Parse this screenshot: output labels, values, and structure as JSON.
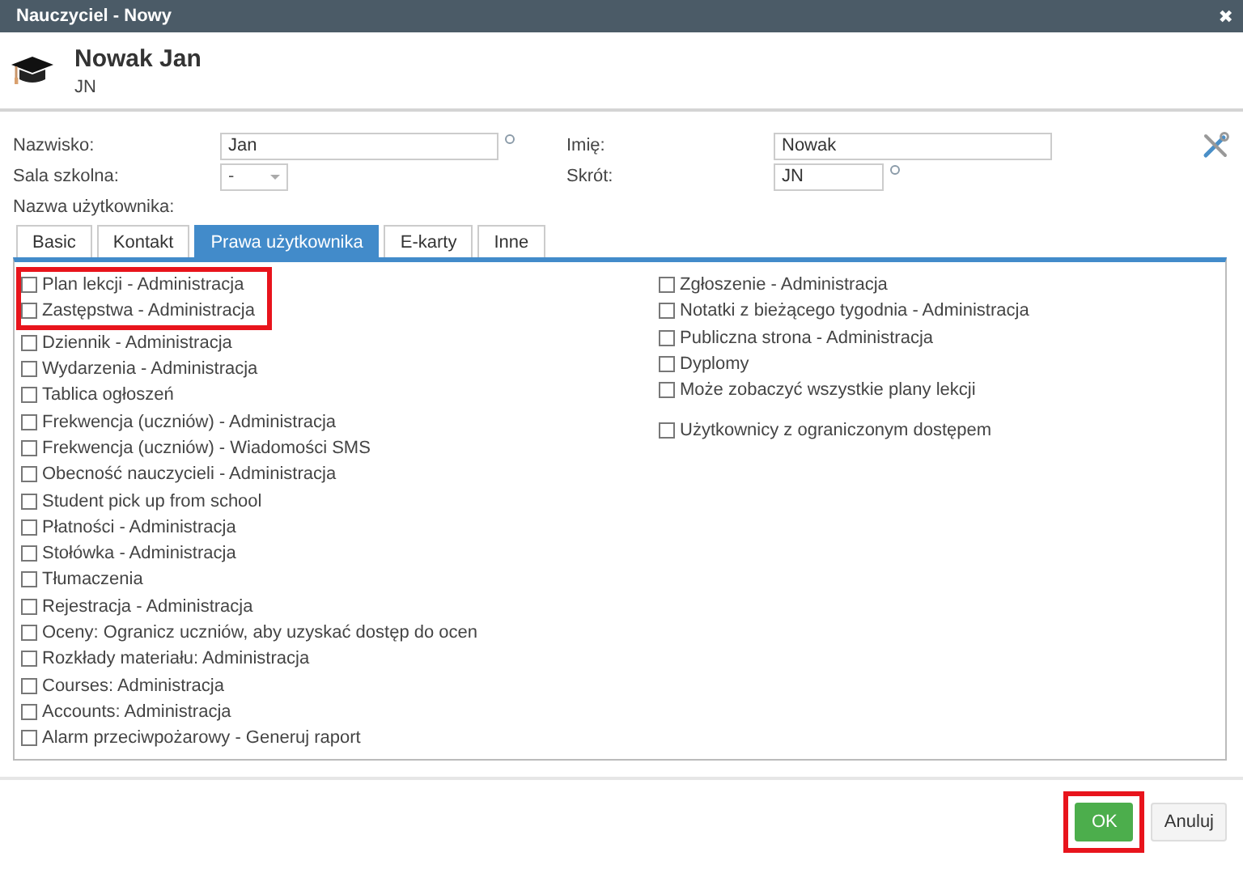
{
  "window": {
    "title": "Nauczyciel - Nowy",
    "close": "✖"
  },
  "header": {
    "name": "Nowak Jan",
    "initials": "JN"
  },
  "form": {
    "left": [
      {
        "kind": "input",
        "label": "Nazwisko:",
        "value": "Jan",
        "required": true
      },
      {
        "kind": "select",
        "label": "Sala szkolna:",
        "value": "-"
      },
      {
        "kind": "text",
        "label": "Nazwa użytkownika:"
      }
    ],
    "right": [
      {
        "kind": "input",
        "label": "Imię:",
        "value": "Nowak",
        "required": false
      },
      {
        "kind": "short",
        "label": "Skrót:",
        "value": "JN",
        "required": true
      }
    ]
  },
  "tabs": [
    {
      "label": "Basic",
      "selected": false
    },
    {
      "label": "Kontakt",
      "selected": false
    },
    {
      "label": "Prawa użytkownika",
      "selected": true
    },
    {
      "label": "E-karty",
      "selected": false
    },
    {
      "label": "Inne",
      "selected": false
    }
  ],
  "permissions_left": [
    {
      "label": "Plan lekcji - Administracja",
      "checked": false,
      "highlighted": true
    },
    {
      "label": "Zastępstwa - Administracja",
      "checked": false,
      "highlighted": true
    },
    {
      "label": "Dziennik - Administracja",
      "checked": false,
      "highlighted": false
    },
    {
      "label": "Wydarzenia - Administracja",
      "checked": false,
      "highlighted": false
    },
    {
      "label": "Tablica ogłoszeń",
      "checked": false,
      "highlighted": false
    },
    {
      "label": "Frekwencja (uczniów) - Administracja",
      "checked": false,
      "highlighted": false
    },
    {
      "label": "Frekwencja (uczniów) - Wiadomości SMS",
      "checked": false,
      "highlighted": false
    },
    {
      "label": "Obecność nauczycieli - Administracja",
      "checked": false,
      "highlighted": false
    },
    {
      "label": "Student pick up from school",
      "checked": false,
      "highlighted": false
    },
    {
      "label": "Płatności - Administracja",
      "checked": false,
      "highlighted": false
    },
    {
      "label": "Stołówka - Administracja",
      "checked": false,
      "highlighted": false
    },
    {
      "label": "Tłumaczenia",
      "checked": false,
      "highlighted": false
    },
    {
      "label": "Rejestracja - Administracja",
      "checked": false,
      "highlighted": false
    },
    {
      "label": "Oceny: Ogranicz uczniów, aby uzyskać dostęp do ocen",
      "checked": false,
      "highlighted": false
    },
    {
      "label": "Rozkłady materiału: Administracja",
      "checked": false,
      "highlighted": false
    },
    {
      "label": "Courses: Administracja",
      "checked": false,
      "highlighted": false
    },
    {
      "label": "Accounts: Administracja",
      "checked": false,
      "highlighted": false
    },
    {
      "label": "Alarm przeciwpożarowy - Generuj raport",
      "checked": false,
      "highlighted": false
    }
  ],
  "permissions_right": [
    {
      "items": [
        {
          "label": "Zgłoszenie - Administracja",
          "checked": false
        },
        {
          "label": "Notatki z bieżącego tygodnia - Administracja",
          "checked": false
        },
        {
          "label": "Publiczna strona - Administracja",
          "checked": false
        },
        {
          "label": "Dyplomy",
          "checked": false
        },
        {
          "label": "Może zobaczyć wszystkie plany lekcji",
          "checked": false
        }
      ]
    },
    {
      "items": [
        {
          "label": "Użytkownicy z ograniczonym dostępem",
          "checked": false
        }
      ]
    }
  ],
  "buttons": [
    {
      "kind": "primary",
      "label": "OK",
      "highlighted": true
    },
    {
      "kind": "secondary",
      "label": "Anuluj",
      "highlighted": false
    }
  ]
}
